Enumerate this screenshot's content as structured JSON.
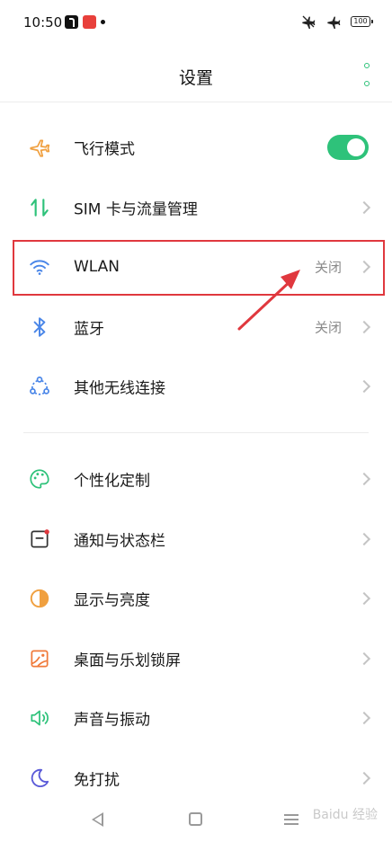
{
  "status_bar": {
    "time": "10:50",
    "battery": "100"
  },
  "header": {
    "title": "设置"
  },
  "groups": [
    {
      "items": [
        {
          "label": "飞行模式",
          "icon": "airplane-icon",
          "toggle_on": true
        },
        {
          "label": "SIM 卡与流量管理",
          "icon": "sim-data-icon"
        },
        {
          "label": "WLAN",
          "icon": "wifi-icon",
          "value": "关闭"
        },
        {
          "label": "蓝牙",
          "icon": "bluetooth-icon",
          "value": "关闭"
        },
        {
          "label": "其他无线连接",
          "icon": "wireless-connection-icon"
        }
      ]
    },
    {
      "items": [
        {
          "label": "个性化定制",
          "icon": "palette-icon"
        },
        {
          "label": "通知与状态栏",
          "icon": "notification-icon"
        },
        {
          "label": "显示与亮度",
          "icon": "brightness-icon"
        },
        {
          "label": "桌面与乐划锁屏",
          "icon": "wallpaper-icon"
        },
        {
          "label": "声音与振动",
          "icon": "sound-icon"
        },
        {
          "label": "免打扰",
          "icon": "moon-icon"
        }
      ]
    }
  ],
  "colors": {
    "accent": "#2ec27a",
    "annotation": "#e0383e",
    "chevron": "#c4c4c4",
    "value_text": "#8a8a8a"
  },
  "watermark": "Baidu 经验"
}
